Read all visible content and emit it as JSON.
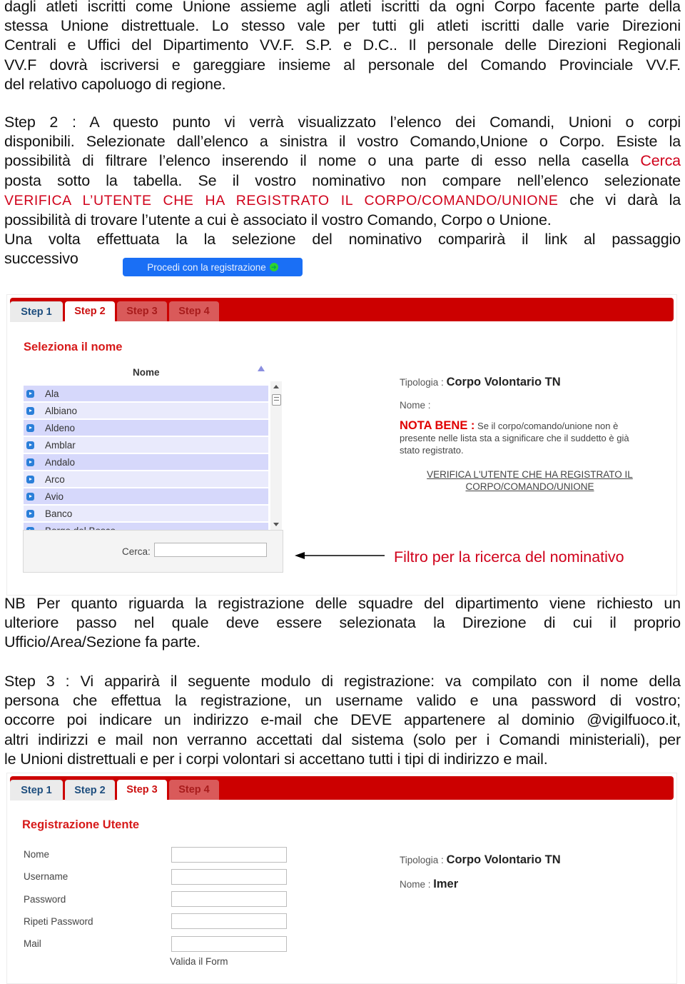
{
  "intro": {
    "lines": [
      "dagli atleti iscritti come Unione assieme agli atleti iscritti da ogni Corpo facente parte della",
      "stessa Unione distrettuale. Lo stesso vale per tutti gli atleti iscritti dalle varie Direzioni",
      "Centrali e Uffici del Dipartimento VV.F. S.P. e D.C.. Il personale delle Direzioni Regionali",
      "VV.F dovrà iscriversi e gareggiare insieme al personale del Comando Provinciale VV.F.",
      "del relativo capoluogo di regione."
    ]
  },
  "step2_text": {
    "l1": "Step 2 :  A questo punto vi verrà visualizzato l’elenco dei Comandi, Unioni o corpi",
    "l2": "disponibili. Selezionate dall’elenco a sinistra il vostro Comando,Unione o Corpo. Esiste la",
    "l3_a": "possibilità di filtrare l’elenco inserendo il nome o una parte di esso nella casella ",
    "l3_red": "Cerca",
    "l4": "posta sotto la tabella. Se il vostro nominativo non compare nell’elenco selezionate",
    "l5_red": "VERIFICA L’UTENTE CHE HA REGISTRATO IL CORPO/COMANDO/UNIONE",
    "l5_b": " che vi darà la",
    "l6": "possibilità di trovare l’utente a cui è associato il vostro Comando, Corpo o Unione.",
    "l7": "Una volta effettuata la la selezione del nominativo comparirà il link al passaggio",
    "l8": "successivo"
  },
  "proceed_button": {
    "label": "Procedi con la registrazione",
    "icon": "arrow-right-circle-icon"
  },
  "screenshot1": {
    "tabs": [
      {
        "label": "Step 1",
        "state": "done"
      },
      {
        "label": "Step 2",
        "state": "active"
      },
      {
        "label": "Step 3",
        "state": "todo"
      },
      {
        "label": "Step 4",
        "state": "todo"
      }
    ],
    "title": "Seleziona il nome",
    "list_header": "Nome",
    "list_items": [
      "Ala",
      "Albiano",
      "Aldeno",
      "Amblar",
      "Andalo",
      "Arco",
      "Avio",
      "Banco",
      "Borgo del Bosco"
    ],
    "search_label": "Cerca:",
    "search_value": "",
    "tipologia_label": "Tipologia :",
    "tipologia_value": "Corpo Volontario TN",
    "nome_label": "Nome :",
    "nota_label": "NOTA BENE :",
    "nota_text": " Se il corpo/comando/unione non è presente nelle lista sta a significare che il suddetto è già stato registrato.",
    "verify_link": "VERIFICA L'UTENTE CHE HA REGISTRATO IL CORPO/COMANDO/UNIONE"
  },
  "annotation": {
    "label": "Filtro per la ricerca del nominativo"
  },
  "nb_text": {
    "l1": "NB Per quanto riguarda la registrazione delle squadre del dipartimento viene richiesto un",
    "l2": "ulteriore passo nel quale deve essere selezionata la Direzione di cui il proprio",
    "l3": "Ufficio/Area/Sezione fa parte."
  },
  "step3_text": {
    "l1": "Step 3 : Vi apparirà il seguente modulo di registrazione: va compilato con il nome della",
    "l2": "persona che effettua la registrazione, un username valido e una password di vostro;",
    "l3": "occorre poi indicare un indirizzo e-mail che DEVE appartenere al dominio @vigilfuoco.it,",
    "l4": "altri indirizzi e mail non verranno accettati dal sistema (solo per i Comandi ministeriali), per",
    "l5": "le Unioni distrettuali e per i corpi volontari si accettano tutti i tipi di indirizzo e mail."
  },
  "screenshot2": {
    "tabs": [
      {
        "label": "Step 1",
        "state": "done"
      },
      {
        "label": "Step 2",
        "state": "done"
      },
      {
        "label": "Step 3",
        "state": "active"
      },
      {
        "label": "Step 4",
        "state": "todo"
      }
    ],
    "title": "Registrazione Utente",
    "fields": [
      {
        "label": "Nome",
        "value": ""
      },
      {
        "label": "Username",
        "value": ""
      },
      {
        "label": "Password",
        "value": ""
      },
      {
        "label": "Ripeti Password",
        "value": ""
      },
      {
        "label": "Mail",
        "value": ""
      }
    ],
    "validate_label": "Valida il Form",
    "tipologia_label": "Tipologia :",
    "tipologia_value": "Corpo Volontario TN",
    "nome_label": "Nome :",
    "nome_value": "Imer"
  },
  "colors": {
    "accent_red": "#cc0000",
    "text_red": "#d0021b",
    "button_blue": "#1a6ff5",
    "list_odd": "#d6d8fb",
    "list_even": "#e9eafc"
  }
}
